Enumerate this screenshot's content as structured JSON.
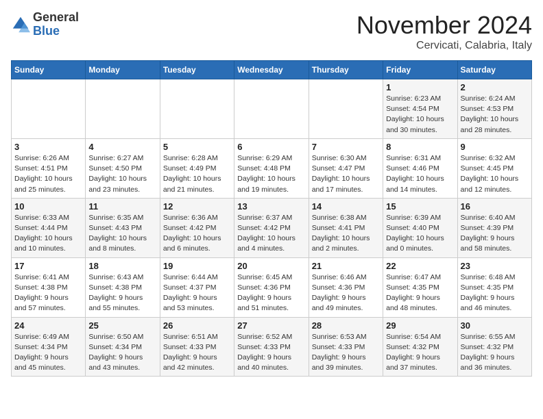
{
  "logo": {
    "general": "General",
    "blue": "Blue"
  },
  "header": {
    "month": "November 2024",
    "location": "Cervicati, Calabria, Italy"
  },
  "days_of_week": [
    "Sunday",
    "Monday",
    "Tuesday",
    "Wednesday",
    "Thursday",
    "Friday",
    "Saturday"
  ],
  "weeks": [
    [
      {
        "day": "",
        "info": ""
      },
      {
        "day": "",
        "info": ""
      },
      {
        "day": "",
        "info": ""
      },
      {
        "day": "",
        "info": ""
      },
      {
        "day": "",
        "info": ""
      },
      {
        "day": "1",
        "info": "Sunrise: 6:23 AM\nSunset: 4:54 PM\nDaylight: 10 hours\nand 30 minutes."
      },
      {
        "day": "2",
        "info": "Sunrise: 6:24 AM\nSunset: 4:53 PM\nDaylight: 10 hours\nand 28 minutes."
      }
    ],
    [
      {
        "day": "3",
        "info": "Sunrise: 6:26 AM\nSunset: 4:51 PM\nDaylight: 10 hours\nand 25 minutes."
      },
      {
        "day": "4",
        "info": "Sunrise: 6:27 AM\nSunset: 4:50 PM\nDaylight: 10 hours\nand 23 minutes."
      },
      {
        "day": "5",
        "info": "Sunrise: 6:28 AM\nSunset: 4:49 PM\nDaylight: 10 hours\nand 21 minutes."
      },
      {
        "day": "6",
        "info": "Sunrise: 6:29 AM\nSunset: 4:48 PM\nDaylight: 10 hours\nand 19 minutes."
      },
      {
        "day": "7",
        "info": "Sunrise: 6:30 AM\nSunset: 4:47 PM\nDaylight: 10 hours\nand 17 minutes."
      },
      {
        "day": "8",
        "info": "Sunrise: 6:31 AM\nSunset: 4:46 PM\nDaylight: 10 hours\nand 14 minutes."
      },
      {
        "day": "9",
        "info": "Sunrise: 6:32 AM\nSunset: 4:45 PM\nDaylight: 10 hours\nand 12 minutes."
      }
    ],
    [
      {
        "day": "10",
        "info": "Sunrise: 6:33 AM\nSunset: 4:44 PM\nDaylight: 10 hours\nand 10 minutes."
      },
      {
        "day": "11",
        "info": "Sunrise: 6:35 AM\nSunset: 4:43 PM\nDaylight: 10 hours\nand 8 minutes."
      },
      {
        "day": "12",
        "info": "Sunrise: 6:36 AM\nSunset: 4:42 PM\nDaylight: 10 hours\nand 6 minutes."
      },
      {
        "day": "13",
        "info": "Sunrise: 6:37 AM\nSunset: 4:42 PM\nDaylight: 10 hours\nand 4 minutes."
      },
      {
        "day": "14",
        "info": "Sunrise: 6:38 AM\nSunset: 4:41 PM\nDaylight: 10 hours\nand 2 minutes."
      },
      {
        "day": "15",
        "info": "Sunrise: 6:39 AM\nSunset: 4:40 PM\nDaylight: 10 hours\nand 0 minutes."
      },
      {
        "day": "16",
        "info": "Sunrise: 6:40 AM\nSunset: 4:39 PM\nDaylight: 9 hours\nand 58 minutes."
      }
    ],
    [
      {
        "day": "17",
        "info": "Sunrise: 6:41 AM\nSunset: 4:38 PM\nDaylight: 9 hours\nand 57 minutes."
      },
      {
        "day": "18",
        "info": "Sunrise: 6:43 AM\nSunset: 4:38 PM\nDaylight: 9 hours\nand 55 minutes."
      },
      {
        "day": "19",
        "info": "Sunrise: 6:44 AM\nSunset: 4:37 PM\nDaylight: 9 hours\nand 53 minutes."
      },
      {
        "day": "20",
        "info": "Sunrise: 6:45 AM\nSunset: 4:36 PM\nDaylight: 9 hours\nand 51 minutes."
      },
      {
        "day": "21",
        "info": "Sunrise: 6:46 AM\nSunset: 4:36 PM\nDaylight: 9 hours\nand 49 minutes."
      },
      {
        "day": "22",
        "info": "Sunrise: 6:47 AM\nSunset: 4:35 PM\nDaylight: 9 hours\nand 48 minutes."
      },
      {
        "day": "23",
        "info": "Sunrise: 6:48 AM\nSunset: 4:35 PM\nDaylight: 9 hours\nand 46 minutes."
      }
    ],
    [
      {
        "day": "24",
        "info": "Sunrise: 6:49 AM\nSunset: 4:34 PM\nDaylight: 9 hours\nand 45 minutes."
      },
      {
        "day": "25",
        "info": "Sunrise: 6:50 AM\nSunset: 4:34 PM\nDaylight: 9 hours\nand 43 minutes."
      },
      {
        "day": "26",
        "info": "Sunrise: 6:51 AM\nSunset: 4:33 PM\nDaylight: 9 hours\nand 42 minutes."
      },
      {
        "day": "27",
        "info": "Sunrise: 6:52 AM\nSunset: 4:33 PM\nDaylight: 9 hours\nand 40 minutes."
      },
      {
        "day": "28",
        "info": "Sunrise: 6:53 AM\nSunset: 4:33 PM\nDaylight: 9 hours\nand 39 minutes."
      },
      {
        "day": "29",
        "info": "Sunrise: 6:54 AM\nSunset: 4:32 PM\nDaylight: 9 hours\nand 37 minutes."
      },
      {
        "day": "30",
        "info": "Sunrise: 6:55 AM\nSunset: 4:32 PM\nDaylight: 9 hours\nand 36 minutes."
      }
    ]
  ]
}
